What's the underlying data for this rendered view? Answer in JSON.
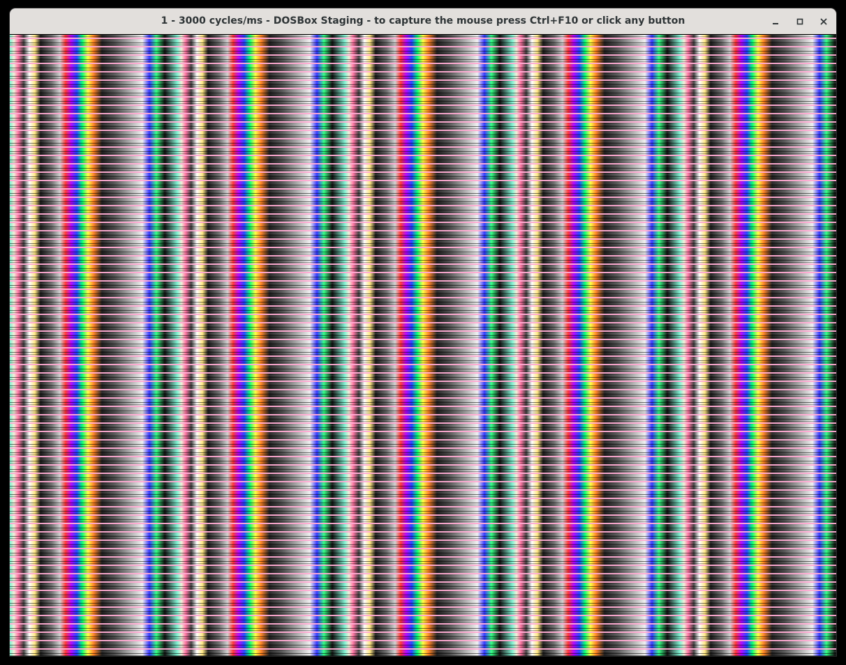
{
  "window": {
    "title": "1 - 3000 cycles/ms - DOSBox Staging - to capture the mouse press Ctrl+F10 or click any button",
    "controls": [
      {
        "name": "minimize",
        "icon": "minimize-icon"
      },
      {
        "name": "maximize",
        "icon": "maximize-icon"
      },
      {
        "name": "close",
        "icon": "close-icon"
      }
    ]
  },
  "viewport": {
    "content": "emulator-display",
    "colors": [
      "#7cf0d0",
      "#ff70a0",
      "#ffaad2",
      "#ffe680",
      "#ff3030",
      "#b000ff",
      "#2040ff",
      "#00ff70",
      "#ffff40",
      "#ff8020",
      "#f0f0f0"
    ]
  }
}
